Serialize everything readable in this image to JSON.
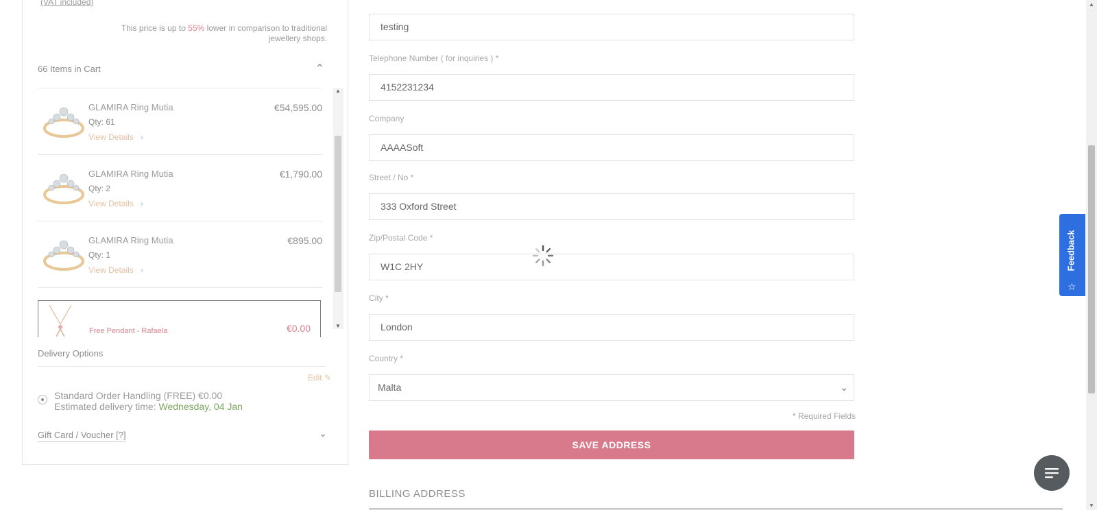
{
  "summary": {
    "vat_label": "(VAT included)",
    "price_note_pre": "This price is up to ",
    "price_note_pct": "55%",
    "price_note_post": " lower in comparison to traditional jewellery shops.",
    "items_header": "66 Items in Cart",
    "items": [
      {
        "name": "GLAMIRA Ring Mutia",
        "qty": "Qty: 61",
        "details": "View Details",
        "price": "€54,595.00"
      },
      {
        "name": "GLAMIRA Ring Mutia",
        "qty": "Qty: 2",
        "details": "View Details",
        "price": "€1,790.00"
      },
      {
        "name": "GLAMIRA Ring Mutia",
        "qty": "Qty: 1",
        "details": "View Details",
        "price": "€895.00"
      }
    ],
    "free_item": {
      "name": "Free Pendant - Rafaela",
      "price": "€0.00"
    },
    "delivery_title": "Delivery Options",
    "edit_label": "Edit",
    "delivery_option": "Standard Order Handling (FREE) €0.00",
    "delivery_estimate_label": "Estimated delivery time: ",
    "delivery_date": "Wednesday, 04 Jan",
    "gift_label": "Gift Card / Voucher [?]"
  },
  "form": {
    "last_name_value": "testing",
    "phone_label": "Telephone Number ( for inquiries ) *",
    "phone_value": "4152231234",
    "company_label": "Company",
    "company_value": "AAAASoft",
    "street_label": "Street / No  *",
    "street_value": "333 Oxford Street",
    "zip_label": "Zip/Postal Code *",
    "zip_value": "W1C 2HY",
    "city_label": "City *",
    "city_value": "London",
    "country_label": "Country *",
    "country_value": "Malta",
    "required_note": "* Required Fields",
    "save_label": "SAVE ADDRESS",
    "billing_title": "BILLING ADDRESS"
  },
  "widgets": {
    "feedback_label": "Feedback"
  },
  "colors": {
    "accent": "#d87a8b",
    "feedback": "#2d6fe0",
    "delivery_date": "#7aa65c"
  }
}
